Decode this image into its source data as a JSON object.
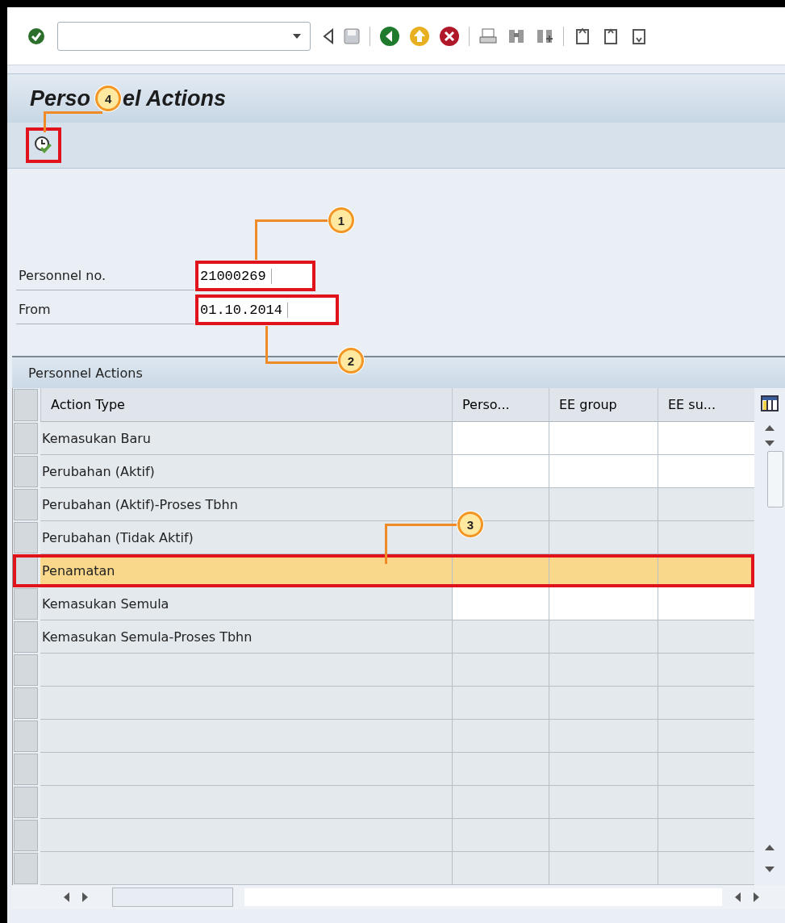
{
  "title": {
    "visible_before": "Perso",
    "visible_after": "el Actions"
  },
  "execute_button": {
    "highlighted": true,
    "callout": "4"
  },
  "fields": [
    {
      "label": "Personnel no.",
      "value": "21000269",
      "highlighted": true,
      "callout": "1"
    },
    {
      "label": "From",
      "value": "01.10.2014",
      "highlighted": true,
      "callout": "2"
    }
  ],
  "table": {
    "title": "Personnel Actions",
    "columns": [
      "Action Type",
      "Perso...",
      "EE group",
      "EE su..."
    ],
    "rows": [
      {
        "action_type": "Kemasukan Baru",
        "input_ready": true,
        "selected": false,
        "highlighted": false
      },
      {
        "action_type": "Perubahan (Aktif)",
        "input_ready": true,
        "selected": false,
        "highlighted": false
      },
      {
        "action_type": "Perubahan (Aktif)-Proses Tbhn",
        "input_ready": false,
        "selected": false,
        "highlighted": false
      },
      {
        "action_type": "Perubahan (Tidak Aktif)",
        "input_ready": false,
        "selected": false,
        "highlighted": false
      },
      {
        "action_type": "Penamatan",
        "input_ready": true,
        "selected": true,
        "highlighted": true,
        "callout": "3"
      },
      {
        "action_type": "Kemasukan Semula",
        "input_ready": true,
        "selected": false,
        "highlighted": false
      },
      {
        "action_type": "Kemasukan Semula-Proses Tbhn",
        "input_ready": false,
        "selected": false,
        "highlighted": false
      },
      {
        "input_ready": false,
        "selected": false,
        "highlighted": false
      },
      {
        "input_ready": false,
        "selected": false,
        "highlighted": false
      },
      {
        "input_ready": false,
        "selected": false,
        "highlighted": false
      },
      {
        "input_ready": false,
        "selected": false,
        "highlighted": false
      },
      {
        "input_ready": false,
        "selected": false,
        "highlighted": false
      },
      {
        "input_ready": false,
        "selected": false,
        "highlighted": false
      },
      {
        "input_ready": false,
        "selected": false,
        "highlighted": false
      }
    ]
  }
}
